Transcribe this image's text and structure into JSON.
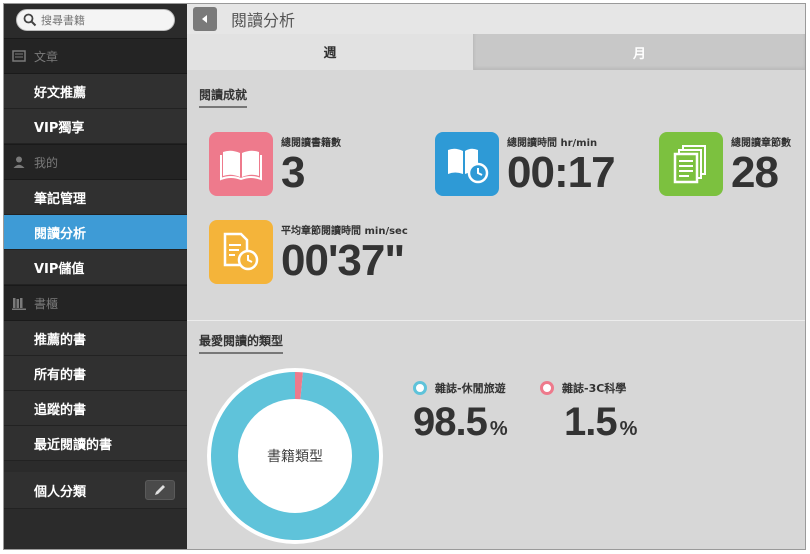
{
  "search": {
    "placeholder": "搜尋書籍"
  },
  "sidebar": {
    "sections": [
      {
        "header": "文章",
        "icon": "document-icon",
        "items": [
          "好文推薦",
          "VIP獨享"
        ]
      },
      {
        "header": "我的",
        "icon": "user-icon",
        "items": [
          "筆記管理",
          "閱讀分析",
          "VIP儲值"
        ]
      },
      {
        "header": "書櫃",
        "icon": "bookshelf-icon",
        "items": [
          "推薦的書",
          "所有的書",
          "追蹤的書",
          "最近閱讀的書"
        ]
      }
    ],
    "active_item": "閱讀分析",
    "personal": "個人分類"
  },
  "header": {
    "title": "閱讀分析"
  },
  "tabs": {
    "week": "週",
    "month": "月",
    "selected": "週"
  },
  "achievements": {
    "title": "閱讀成就",
    "stats": [
      {
        "label": "總閱讀書籍數",
        "value": "3",
        "icon": "open-book-icon",
        "color": "#ee7a8c"
      },
      {
        "label": "總閱讀時間 hr/min",
        "value": "00:17",
        "icon": "book-clock-icon",
        "color": "#2e9ad6"
      },
      {
        "label": "總閱讀章節數",
        "value": "28",
        "icon": "pages-icon",
        "color": "#7cc13f"
      },
      {
        "label": "平均章節閱讀時間 min/sec",
        "value": "00'37\"",
        "icon": "document-clock-icon",
        "color": "#f4b43a"
      }
    ]
  },
  "genres": {
    "title": "最愛閱讀的類型",
    "donut_center": "書籍類型",
    "items": [
      {
        "label": "雜誌-休閒旅遊",
        "value": 98.5,
        "display": "98.5",
        "unit": "%",
        "color": "#5fc3da"
      },
      {
        "label": "雜誌-3C科學",
        "value": 1.5,
        "display": "1.5",
        "unit": "%",
        "color": "#ee7a8c"
      }
    ]
  }
}
